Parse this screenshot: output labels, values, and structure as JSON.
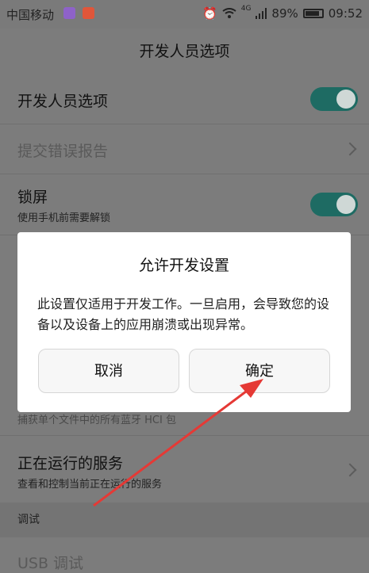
{
  "status_bar": {
    "carrier": "中国移动",
    "signal": "4G",
    "battery": "89%",
    "time": "09:52"
  },
  "header": {
    "title": "开发人员选项"
  },
  "settings": [
    {
      "title": "开发人员选项",
      "toggle": "on"
    },
    {
      "title": "提交错误报告"
    },
    {
      "title": "锁屏",
      "subtitle": "使用手机前需要解锁",
      "toggle": "on"
    }
  ],
  "partial_row": {
    "subtitle": "捕获单个文件中的所有蓝牙 HCI 包"
  },
  "running_services": {
    "title": "正在运行的服务",
    "subtitle": "查看和控制当前正在运行的服务"
  },
  "section": {
    "label": "调试"
  },
  "usb": {
    "label": "USB 调试"
  },
  "dialog": {
    "title": "允许开发设置",
    "message": "此设置仅适用于开发工作。一旦启用，会导致您的设备以及设备上的应用崩溃或出现异常。",
    "cancel": "取消",
    "confirm": "确定"
  },
  "colors": {
    "toggle_on": "#1e6b63",
    "overlay_dim": "#7c7c7c",
    "annotation_arrow": "#e53935"
  }
}
